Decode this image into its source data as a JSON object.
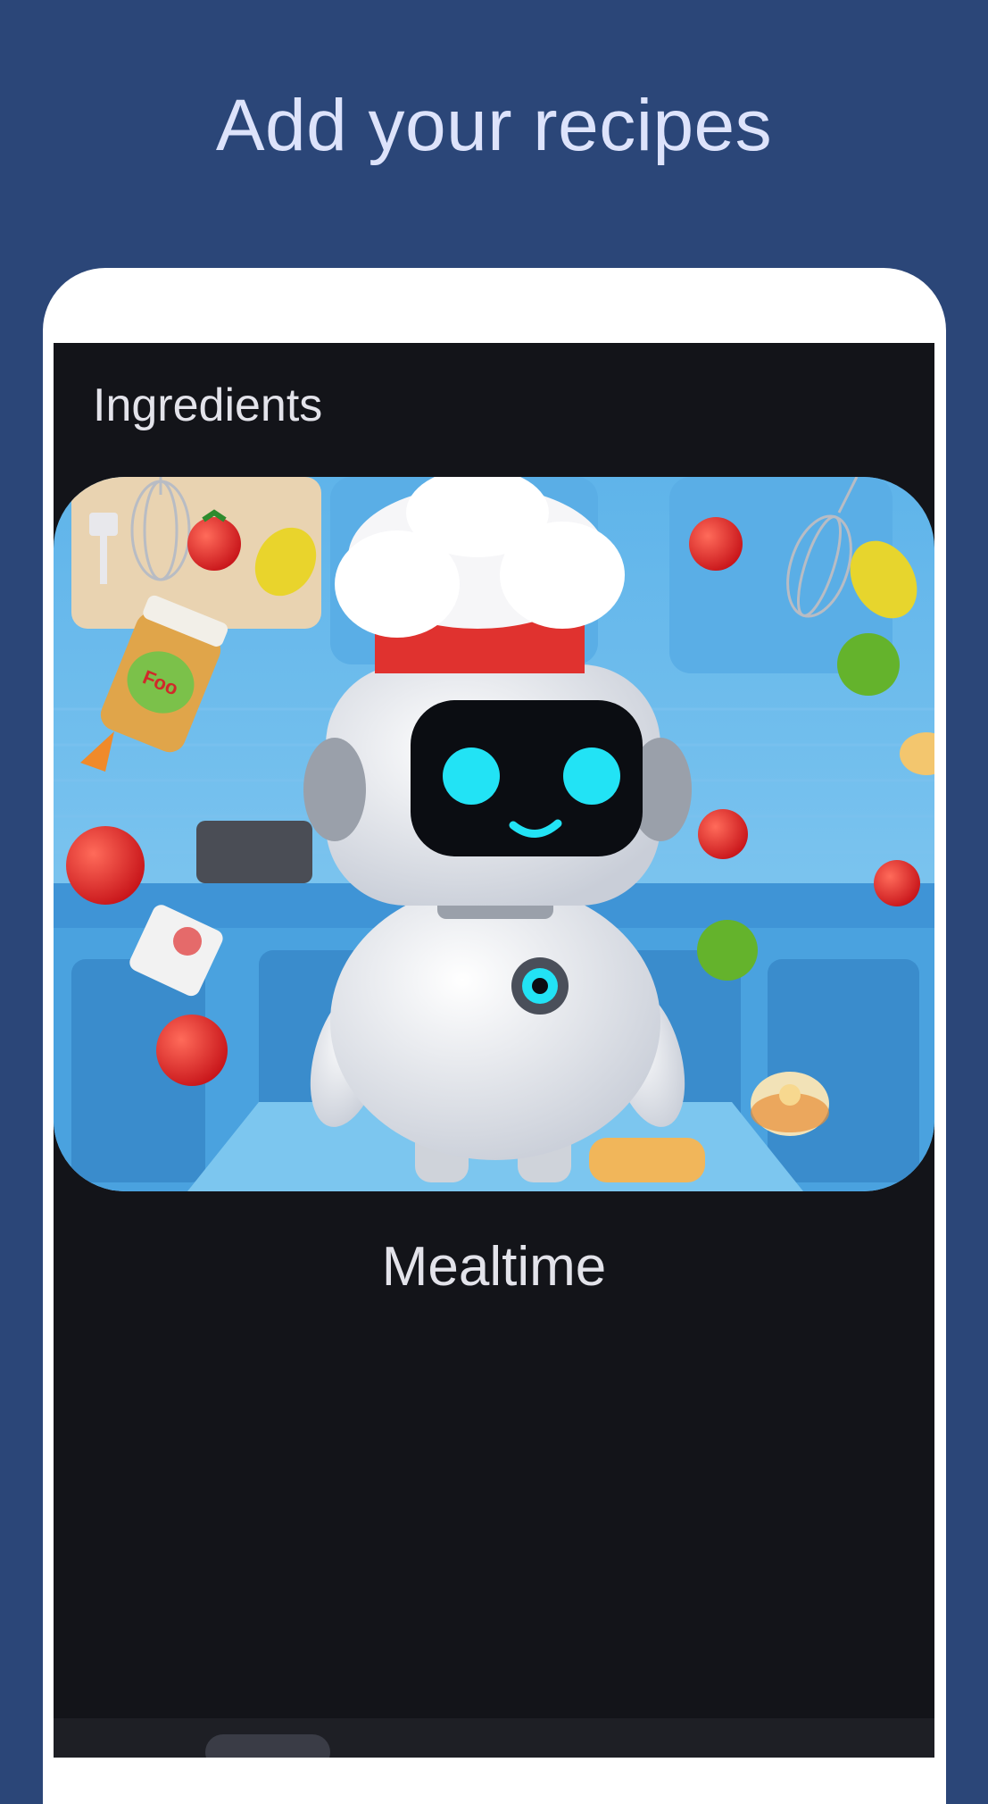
{
  "onboarding": {
    "headline": "Add your recipes"
  },
  "screen": {
    "title": "Ingredients",
    "hero_image_icon": "chef-robot-kitchen-illustration",
    "caption": "Mealtime",
    "jar_label": "Foo"
  },
  "colors": {
    "background": "#2b4678",
    "headline_text": "#dde3fb",
    "screen_background": "#131419",
    "screen_text": "#e3e3ea",
    "robot_eyes": "#22e3f5",
    "chef_hat_band": "#e0322f"
  }
}
